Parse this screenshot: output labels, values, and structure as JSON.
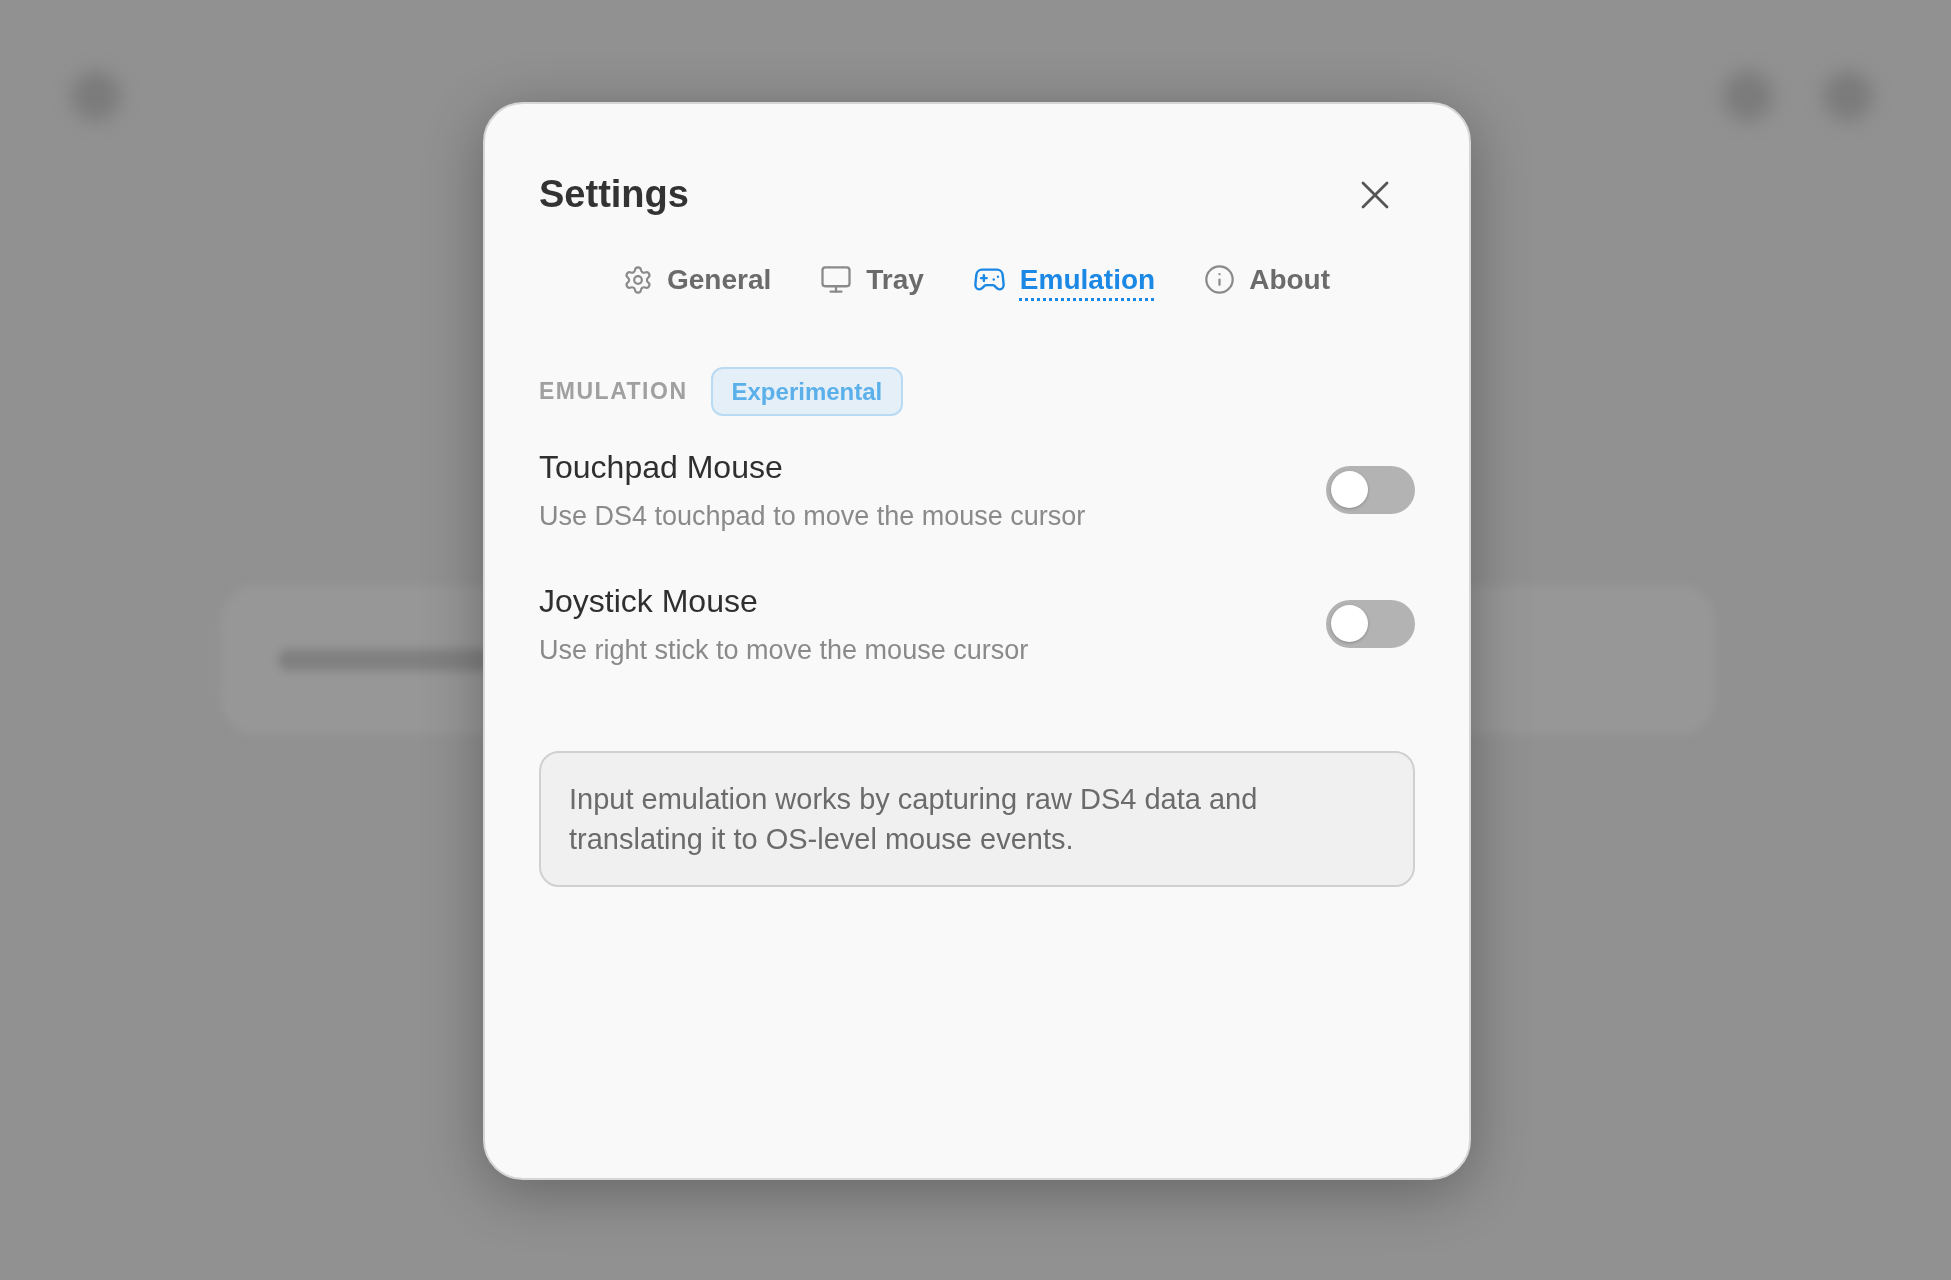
{
  "dialog": {
    "title": "Settings"
  },
  "tabs": [
    {
      "label": "General",
      "selected": false
    },
    {
      "label": "Tray",
      "selected": false
    },
    {
      "label": "Emulation",
      "selected": true
    },
    {
      "label": "About",
      "selected": false
    }
  ],
  "section": {
    "label": "EMULATION",
    "badge": "Experimental"
  },
  "settings": [
    {
      "title": "Touchpad Mouse",
      "description": "Use DS4 touchpad to move the mouse cursor",
      "on": false
    },
    {
      "title": "Joystick Mouse",
      "description": "Use right stick to move the mouse cursor",
      "on": false
    }
  ],
  "note": "Input emulation works by capturing raw DS4 data and translating it to OS-level mouse events."
}
